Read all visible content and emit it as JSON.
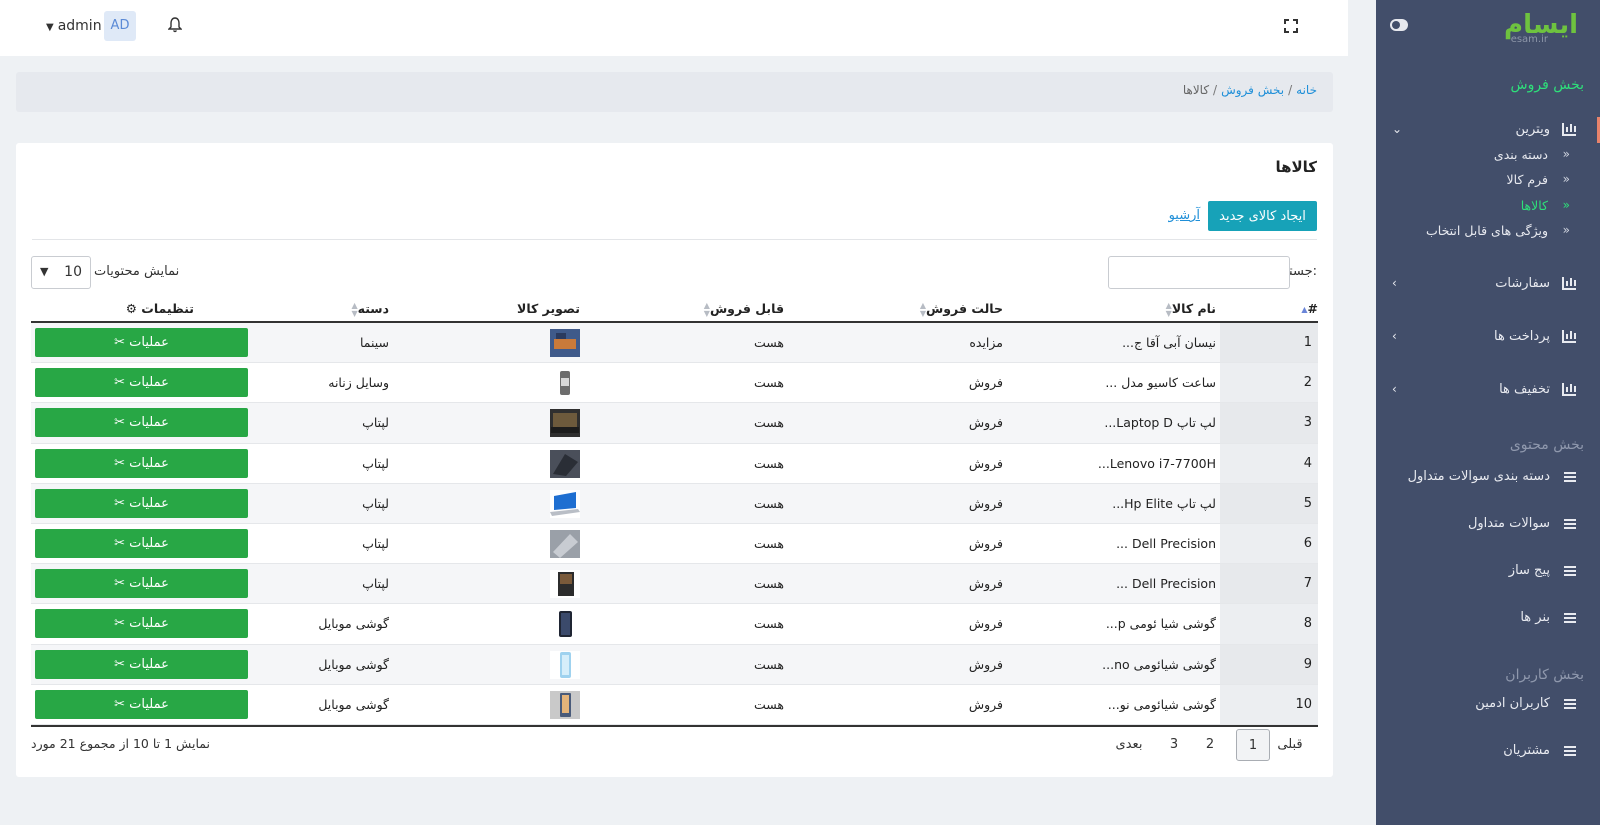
{
  "logo": {
    "main": "ایسام",
    "sub": "esam.ir"
  },
  "header": {
    "user_name": "admin",
    "avatar_initials": "AD"
  },
  "sidebar": {
    "section_sales": "بخش فروش",
    "showcase": "ویترین",
    "showcase_sub": [
      "دسته بندی",
      "فرم کالا",
      "کالاها",
      "ویژگی های قابل انتخاب"
    ],
    "orders": "سفارشات",
    "payments": "پرداخت ها",
    "discounts": "تخفیف ها",
    "section_content": "بخش محتوی",
    "faq_categories": "دسته بندی سوالات متداول",
    "faq": "سوالات متداول",
    "page_builder": "پیج ساز",
    "banners": "بنر ها",
    "section_users": "بخش کاربران",
    "admin_users": "کاربران ادمین",
    "customers": "مشتریان"
  },
  "breadcrumb": {
    "home": "خانه",
    "section": "بخش فروش",
    "current": "کالاها",
    "sep": "/"
  },
  "card": {
    "title": "کالاها",
    "create_button": "ایجاد کالای جدید",
    "archive_link": "آرشیو",
    "search_label": "جستجو:",
    "show_label": "نمایش محتویات",
    "page_size": "10"
  },
  "table": {
    "headers": {
      "num": "#",
      "name": "نام کالا",
      "mode": "حالت فروش",
      "sellable": "قابل فروش",
      "image": "تصویر کالا",
      "category": "دسته",
      "settings": "تنظیمات"
    },
    "rows": [
      {
        "num": "1",
        "name": "نیسان آبی آقا ج...",
        "mode": "مزایده",
        "sellable": "هست",
        "category": "سینما",
        "ops": "عملیات"
      },
      {
        "num": "2",
        "name": "ساعت کاسیو مدل ...",
        "mode": "فروش",
        "sellable": "هست",
        "category": "وسایل زنانه",
        "ops": "عملیات"
      },
      {
        "num": "3",
        "name": "لپ تاپ Laptop D...",
        "mode": "فروش",
        "sellable": "هست",
        "category": "لپتاپ",
        "ops": "عملیات"
      },
      {
        "num": "4",
        "name": "Lenovo i7-7700H...",
        "mode": "فروش",
        "sellable": "هست",
        "category": "لپتاپ",
        "ops": "عملیات"
      },
      {
        "num": "5",
        "name": "لپ تاپ Hp Elite...",
        "mode": "فروش",
        "sellable": "هست",
        "category": "لپتاپ",
        "ops": "عملیات"
      },
      {
        "num": "6",
        "name": "Dell Precision ...",
        "mode": "فروش",
        "sellable": "هست",
        "category": "لپتاپ",
        "ops": "عملیات"
      },
      {
        "num": "7",
        "name": "Dell Precision ...",
        "mode": "فروش",
        "sellable": "هست",
        "category": "لپتاپ",
        "ops": "عملیات"
      },
      {
        "num": "8",
        "name": "گوشی شیا ئومی p...",
        "mode": "فروش",
        "sellable": "هست",
        "category": "گوشی موبایل",
        "ops": "عملیات"
      },
      {
        "num": "9",
        "name": "گوشی شیائومی no...",
        "mode": "فروش",
        "sellable": "هست",
        "category": "گوشی موبایل",
        "ops": "عملیات"
      },
      {
        "num": "10",
        "name": "گوشی شیائومی نو...",
        "mode": "فروش",
        "sellable": "هست",
        "category": "گوشی موبایل",
        "ops": "عملیات"
      }
    ]
  },
  "footer": {
    "info": "نمایش 1 تا 10 از مجموع 21 مورد",
    "prev": "قبلی",
    "pages": [
      "1",
      "2",
      "3"
    ],
    "next": "بعدی"
  }
}
